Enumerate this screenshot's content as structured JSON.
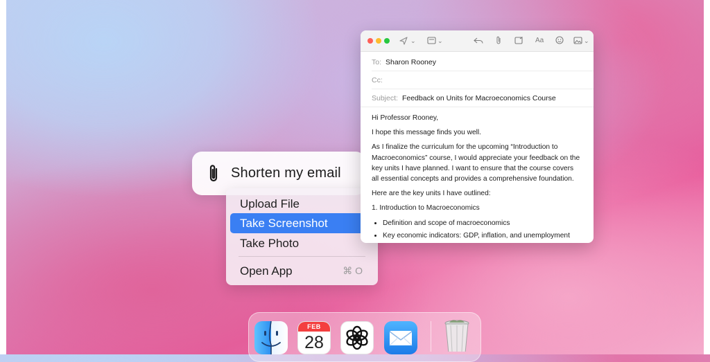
{
  "prompt": {
    "text": "Shorten my email",
    "icon": "paperclip-icon"
  },
  "menu": {
    "items": [
      {
        "label": "Upload File",
        "selected": false
      },
      {
        "label": "Take Screenshot",
        "selected": true
      },
      {
        "label": "Take Photo",
        "selected": false
      },
      {
        "label": "Open App",
        "selected": false,
        "shortcut": "⌘ O"
      }
    ],
    "selected_color": "#3a7ff3"
  },
  "mail": {
    "to_label": "To:",
    "to": "Sharon Rooney",
    "cc_label": "Cc:",
    "cc": "",
    "subject_label": "Subject:",
    "subject": "Feedback on Units for Macroeconomics Course",
    "greeting": "Hi Professor Rooney,",
    "p1": "I hope this message finds you well.",
    "p2": "As I finalize the curriculum for the upcoming “Introduction to Macroeconomics” course, I would appreciate your feedback on the key units I have planned. I want to ensure that the course covers all essential concepts and provides a comprehensive foundation.",
    "p3": "Here are the key units I have outlined:",
    "unit1": "1. Introduction to Macroeconomics",
    "bullets": [
      "Definition and scope of macroeconomics",
      "Key economic indicators: GDP, inflation, and unemployment"
    ],
    "toolbar_icons": [
      "send-icon",
      "header-fields-icon",
      "reply-icon",
      "attachment-icon",
      "markup-icon",
      "format-text-icon",
      "emoji-icon",
      "photo-browser-icon"
    ],
    "format_label": "Aa"
  },
  "dock": {
    "calendar_month": "FEB",
    "calendar_day": "28",
    "apps": [
      "finder",
      "calendar",
      "chatgpt",
      "mail",
      "trash"
    ]
  }
}
